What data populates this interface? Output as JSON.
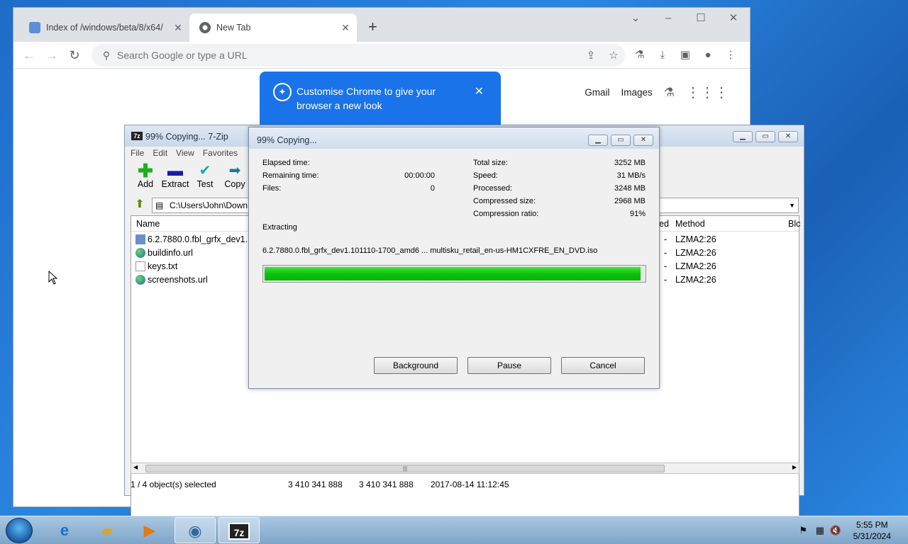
{
  "chrome": {
    "tabs": [
      {
        "title": "Index of /windows/beta/8/x64/"
      },
      {
        "title": "New Tab"
      }
    ],
    "omnibox_placeholder": "Search Google or type a URL",
    "links": {
      "gmail": "Gmail",
      "images": "Images"
    },
    "promo_text": "Customise Chrome to give your browser a new look"
  },
  "zip": {
    "title": "99% Copying... 7-Zip",
    "menu": [
      "File",
      "Edit",
      "View",
      "Favorites"
    ],
    "tools": [
      "Add",
      "Extract",
      "Test",
      "Copy"
    ],
    "path": "C:\\Users\\John\\Down",
    "columns": {
      "name": "Name",
      "packed_tail": "ed",
      "method": "Method",
      "block": "Blc"
    },
    "files": [
      {
        "name": "6.2.7880.0.fbl_grfx_dev1....",
        "packed": "-",
        "method": "LZMA2:26",
        "icon": "iso-icon"
      },
      {
        "name": "buildinfo.url",
        "packed": "-",
        "method": "LZMA2:26",
        "icon": "globe-icon"
      },
      {
        "name": "keys.txt",
        "packed": "-",
        "method": "LZMA2:26",
        "icon": "text-file-icon"
      },
      {
        "name": "screenshots.url",
        "packed": "-",
        "method": "LZMA2:26",
        "icon": "globe-icon"
      }
    ],
    "status": {
      "selected": "1 / 4 object(s) selected",
      "size": "3 410 341 888",
      "packed": "3 410 341 888",
      "modified": "2017-08-14 11:12:45"
    }
  },
  "dialog": {
    "title": "99% Copying...",
    "left": [
      {
        "label": "Elapsed time:",
        "value": ""
      },
      {
        "label": "Remaining time:",
        "value": "00:00:00"
      },
      {
        "label": "Files:",
        "value": "0"
      }
    ],
    "right": [
      {
        "label": "Total size:",
        "value": "3252 MB"
      },
      {
        "label": "Speed:",
        "value": "31 MB/s"
      },
      {
        "label": "Processed:",
        "value": "3248 MB"
      },
      {
        "label": "Compressed size:",
        "value": "2968 MB"
      },
      {
        "label": "Compression ratio:",
        "value": "91%"
      }
    ],
    "operation": "Extracting",
    "current_file": "6.2.7880.0.fbl_grfx_dev1.101110-1700_amd6 ... multisku_retail_en-us-HM1CXFRE_EN_DVD.iso",
    "progress": 0.99,
    "buttons": {
      "background": "Background",
      "pause": "Pause",
      "cancel": "Cancel"
    }
  },
  "taskbar": {
    "time": "5:55 PM",
    "date": "5/31/2024"
  },
  "colors": {
    "progress_green": "#0cc10c",
    "chrome_blue": "#1a73e8"
  }
}
